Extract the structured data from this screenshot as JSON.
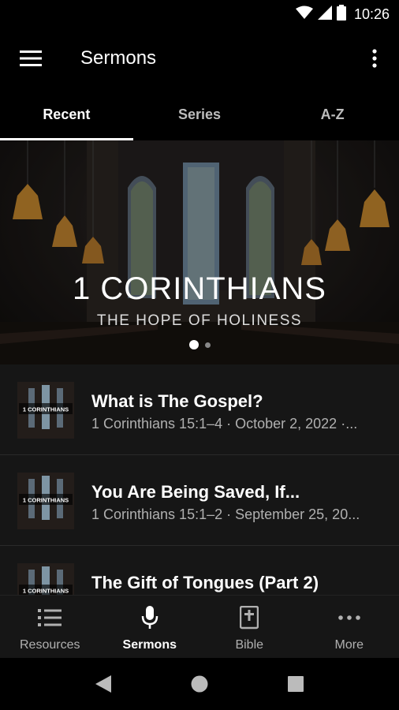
{
  "status_bar": {
    "time": "10:26",
    "icons": [
      "wifi-icon",
      "signal-icon",
      "battery-icon"
    ]
  },
  "app_bar": {
    "title": "Sermons",
    "menu_icon": "hamburger-menu-icon",
    "overflow_icon": "more-vertical-icon"
  },
  "tabs": [
    {
      "label": "Recent",
      "active": true
    },
    {
      "label": "Series",
      "active": false
    },
    {
      "label": "A-Z",
      "active": false
    }
  ],
  "hero": {
    "title": "1 CORINTHIANS",
    "subtitle": "THE HOPE OF HOLINESS",
    "carousel_pages": 2,
    "carousel_active": 0
  },
  "sermons": [
    {
      "title": "What is The Gospel?",
      "subtitle": "1 Corinthians 15:1–4 · October 2, 2022 ·...",
      "thumb_label": "1 CORINTHIANS"
    },
    {
      "title": "You Are Being Saved, If...",
      "subtitle": "1 Corinthians 15:1–2 · September 25, 20...",
      "thumb_label": "1 CORINTHIANS"
    },
    {
      "title": "The Gift of Tongues (Part 2)",
      "subtitle": "",
      "thumb_label": "1 CORINTHIANS"
    }
  ],
  "bottom_nav": [
    {
      "label": "Resources",
      "icon": "list-icon",
      "active": false
    },
    {
      "label": "Sermons",
      "icon": "microphone-icon",
      "active": true
    },
    {
      "label": "Bible",
      "icon": "bible-icon",
      "active": false
    },
    {
      "label": "More",
      "icon": "more-horizontal-icon",
      "active": false
    }
  ],
  "system_nav": [
    "back-icon",
    "home-icon",
    "recents-icon"
  ],
  "colors": {
    "background": "#000000",
    "list_background": "#161616",
    "active": "#ffffff",
    "inactive": "#b0b0b0"
  }
}
